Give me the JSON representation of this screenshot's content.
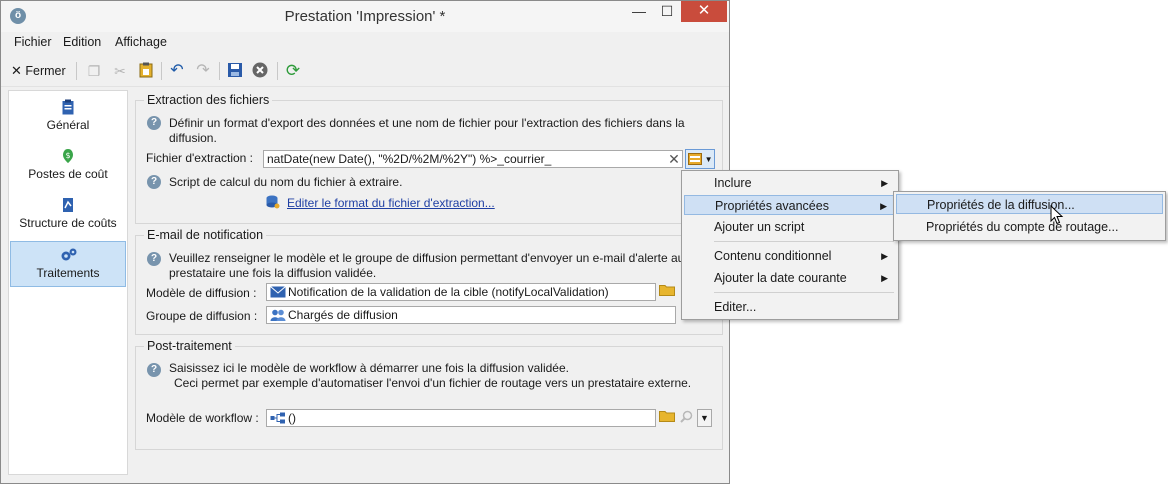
{
  "window": {
    "title": "Prestation 'Impression' *",
    "minimize": "—",
    "maximize": "☐",
    "close": "✕"
  },
  "menu": [
    "Fichier",
    "Edition",
    "Affichage"
  ],
  "toolbar": {
    "close_label": "Fermer"
  },
  "sidebar": [
    {
      "label": "Général",
      "icon": "clipboard-icon"
    },
    {
      "label": "Postes de coût",
      "icon": "money-icon"
    },
    {
      "label": "Structure de coûts",
      "icon": "document-icon"
    },
    {
      "label": "Traitements",
      "icon": "gears-icon"
    }
  ],
  "extraction": {
    "group_title": "Extraction des fichiers",
    "desc_line1": "Définir un format d'export des données et une nom de fichier pour l'extraction des fichiers dans la",
    "desc_line2": "diffusion.",
    "file_label": "Fichier d'extraction :",
    "file_value": "natDate(new Date(), \"%2D/%2M/%2Y\") %>_courrier_",
    "script_help": "Script de calcul du nom du fichier à extraire.",
    "edit_link": "Editer le format du fichier d'extraction..."
  },
  "email": {
    "group_title": "E-mail de notification",
    "desc_line1": "Veuillez renseigner le modèle et le groupe de diffusion permettant d'envoyer un e-mail d'alerte au",
    "desc_line2": "prestataire une fois la diffusion validée.",
    "model_label": "Modèle de diffusion :",
    "model_value": "Notification de la validation de la cible (notifyLocalValidation)",
    "group_label": "Groupe de diffusion :",
    "group_value": "Chargés de diffusion"
  },
  "post": {
    "group_title": "Post-traitement",
    "desc_line1": "Saisissez ici le modèle de workflow à démarrer une fois la diffusion validée.",
    "desc_line2": "Ceci permet par exemple d'automatiser l'envoi d'un fichier de routage vers un prestataire externe.",
    "workflow_label": "Modèle de workflow :",
    "workflow_value": "()"
  },
  "context_menu": [
    {
      "label": "Inclure",
      "submenu": true
    },
    {
      "label": "Propriétés avancées",
      "submenu": true
    },
    {
      "label": "Ajouter un script",
      "submenu": false
    },
    {
      "label": "Contenu conditionnel",
      "submenu": true
    },
    {
      "label": "Ajouter la date courante",
      "submenu": true
    },
    {
      "label": "Editer...",
      "submenu": false
    }
  ],
  "submenu": [
    {
      "label": "Propriétés de la diffusion..."
    },
    {
      "label": "Propriétés du compte de routage..."
    }
  ],
  "colors": {
    "accent": "#1f3fa3",
    "selection": "#cfe0f4",
    "close_button": "#c94c3c"
  }
}
